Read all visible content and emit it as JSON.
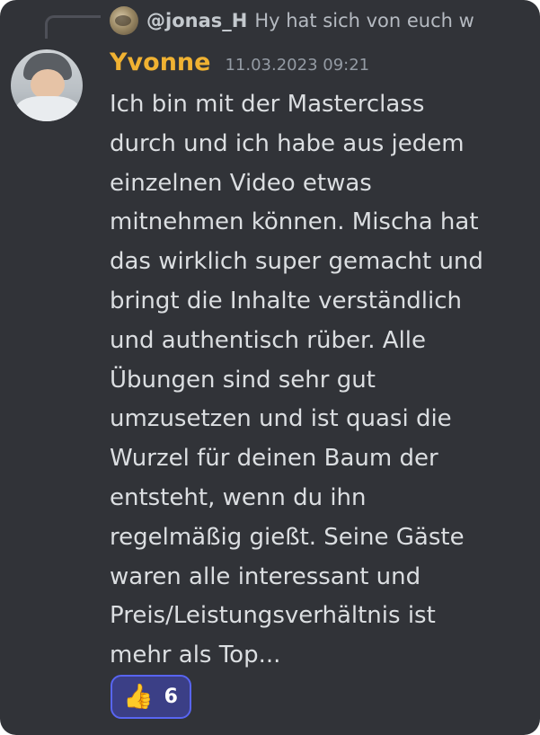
{
  "reply": {
    "username": "@jonas_H",
    "preview": "Hy hat sich von euch w"
  },
  "message": {
    "author": "Yvonne",
    "timestamp": "11.03.2023 09:21",
    "text": "Ich bin mit der Masterclass\ndurch und ich habe aus jedem\neinzelnen Video etwas\nmitnehmen können. Mischa hat\ndas wirklich super gemacht und\nbringt die Inhalte verständlich\nund authentisch rüber. Alle\nÜbungen sind sehr gut\numzusetzen und ist quasi die\nWurzel für deinen Baum der\nentsteht, wenn du ihn\nregelmäßig gießt. Seine Gäste\nwaren alle interessant und\nPreis/Leistungsverhältnis ist\nmehr als Top..."
  },
  "reaction": {
    "icon": "thumbs-up-icon",
    "emoji": "👍",
    "count": "6"
  },
  "colors": {
    "background": "#313338",
    "author": "#f0b232",
    "reaction_border": "#5865f2",
    "reaction_fill": "#3b3f86"
  }
}
